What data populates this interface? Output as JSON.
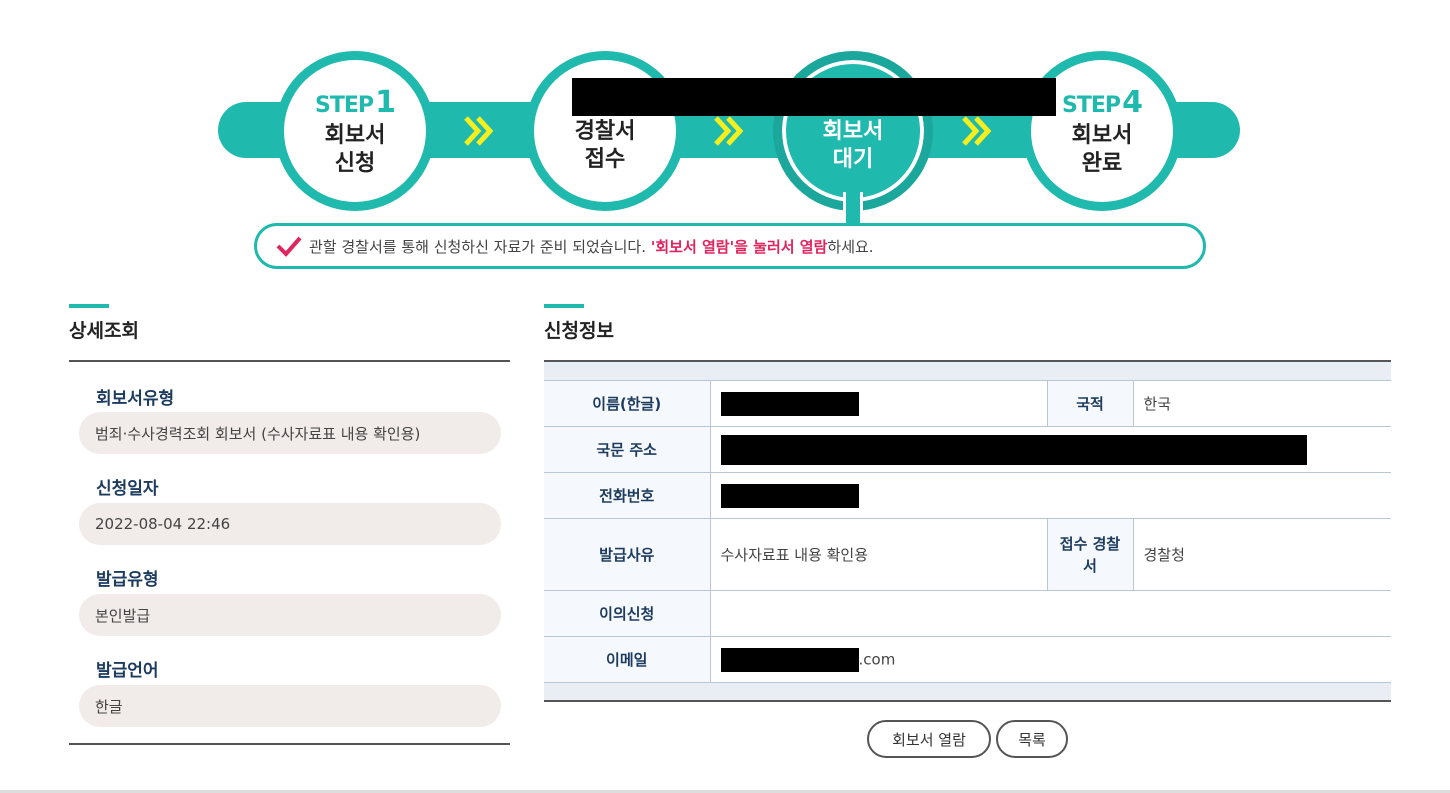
{
  "steps": [
    {
      "word": "STEP",
      "num": "1",
      "title_line1": "회보서",
      "title_line2": "신청"
    },
    {
      "word": "",
      "num": "",
      "title_line1": "경찰서",
      "title_line2": "접수"
    },
    {
      "word": "",
      "num": "",
      "title_line1": "회보서",
      "title_line2": "대기"
    },
    {
      "word": "STEP",
      "num": "4",
      "title_line1": "회보서",
      "title_line2": "완료"
    }
  ],
  "notice": {
    "text_before": "관할 경찰서를 통해 신청하신 자료가 준비 되었습니다. ",
    "highlight": "'회보서 열람'을 눌러서 열람",
    "text_after": "하세요."
  },
  "detail": {
    "heading": "상세조회",
    "fields": [
      {
        "label": "회보서유형",
        "value": "범죄·수사경력조회 회보서 (수사자료표 내용 확인용)"
      },
      {
        "label": "신청일자",
        "value": "2022-08-04 22:46"
      },
      {
        "label": "발급유형",
        "value": "본인발급"
      },
      {
        "label": "발급언어",
        "value": "한글"
      }
    ]
  },
  "info": {
    "heading": "신청정보",
    "name_label": "이름(한글)",
    "nationality_label": "국적",
    "nationality_value": "한국",
    "address_label": "국문 주소",
    "phone_label": "전화번호",
    "reason_label": "발급사유",
    "reason_value": "수사자료표 내용 확인용",
    "station_label": "접수 경찰서",
    "station_value": "경찰청",
    "objection_label": "이의신청",
    "objection_value": "",
    "email_label": "이메일",
    "email_suffix": ".com"
  },
  "buttons": {
    "view": "회보서 열람",
    "list": "목록"
  },
  "colors": {
    "accent": "#20b9ae",
    "highlight": "#e0245e",
    "chevron": "#f5ef1d"
  }
}
